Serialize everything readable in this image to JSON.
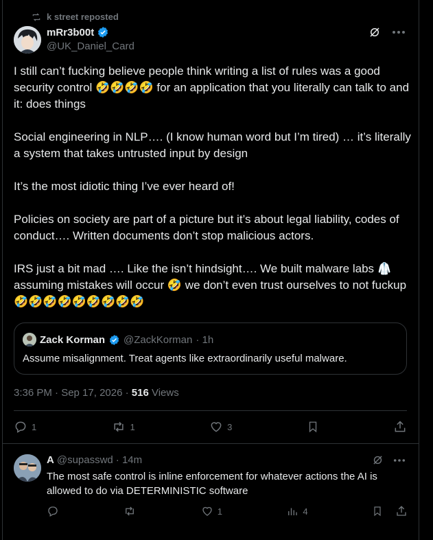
{
  "repost": {
    "label": "k street reposted"
  },
  "tweet": {
    "display_name": "mRr3b00t",
    "handle": "@UK_Daniel_Card",
    "paragraphs": [
      "I still can’t fucking believe people think writing a list of rules was a good security control 🤣🤣🤣🤣 for an application that you literally can talk to and it: does things",
      "Social engineering in NLP…. (I know human word but I’m tired) … it’s literally a system that takes untrusted input by design",
      "It’s the most idiotic thing I’ve ever heard of!",
      "Policies on society are part of a picture but it’s about legal liability, codes of conduct…. Written documents don’t stop malicious actors.",
      "IRS just a bit mad …. Like the isn’t hindsight…. We built malware labs 🥼 assuming mistakes will occur 🤣 we don’t even trust ourselves to not fuckup 🤣🤣🤣🤣🤣🤣🤣🤣🤣"
    ],
    "quote": {
      "display_name": "Zack Korman",
      "handle": "@ZackKorman",
      "time": "· 1h",
      "text": "Assume misalignment. Treat agents like extraordinarily useful malware."
    },
    "timestamp": "3:36 PM · Sep 17, 2026 · ",
    "views_count": "516",
    "views_label": " Views",
    "counts": {
      "replies": "1",
      "reposts": "1",
      "likes": "3"
    }
  },
  "reply": {
    "display_name": "A",
    "handle": "@supasswd",
    "time": "· 14m",
    "text": "The most safe control is inline enforcement for whatever actions the AI is allowed to do via DETERMINISTIC software",
    "counts": {
      "likes": "1",
      "views": "4"
    }
  },
  "colors": {
    "background": "#000000",
    "text": "#e7e9ea",
    "muted": "#71767b",
    "verified": "#1d9bf0",
    "border": "#2f3336"
  }
}
